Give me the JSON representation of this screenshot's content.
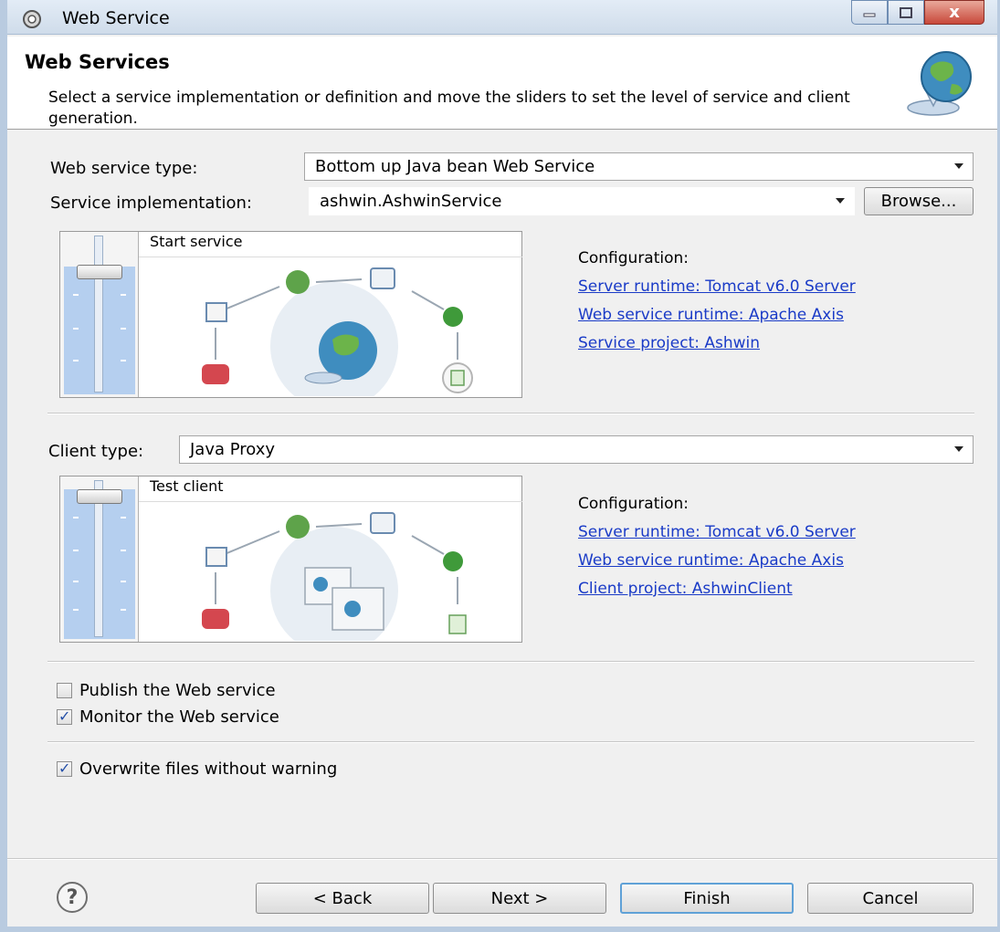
{
  "window": {
    "title": "Web Service",
    "minimize_icon": "minimize-icon",
    "maximize_icon": "maximize-icon",
    "close_icon": "close-icon",
    "close_glyph": "x"
  },
  "banner": {
    "title": "Web Services",
    "description": "Select a service implementation or definition and move the sliders to set the level of service and client generation.",
    "icon": "web-services-globe-icon"
  },
  "service": {
    "type_label": "Web service type:",
    "type_value": "Bottom up Java bean Web Service",
    "impl_label": "Service implementation:",
    "impl_value": "ashwin.AshwinService",
    "browse_label": "Browse...",
    "slider_caption": "Start service",
    "slider_level": 0.17,
    "config_heading": "Configuration:",
    "config_links": [
      "Server runtime: Tomcat v6.0 Server",
      "Web service runtime: Apache Axis",
      "Service project: Ashwin"
    ]
  },
  "client": {
    "type_label": "Client type:",
    "type_value": "Java Proxy",
    "slider_caption": "Test client",
    "slider_level": 0.0,
    "config_heading": "Configuration:",
    "config_links": [
      "Server runtime: Tomcat v6.0 Server",
      "Web service runtime: Apache Axis",
      "Client project: AshwinClient"
    ]
  },
  "options": {
    "publish": {
      "label": "Publish the Web service",
      "checked": false
    },
    "monitor": {
      "label": "Monitor the Web service",
      "checked": true
    },
    "overwrite": {
      "label": "Overwrite files without warning",
      "checked": true
    }
  },
  "footer": {
    "help_icon": "help-icon",
    "help_glyph": "?",
    "back_label": "< Back",
    "next_label": "Next >",
    "finish_label": "Finish",
    "cancel_label": "Cancel"
  },
  "colors": {
    "link": "#1a3bc7",
    "slider_fill": "#b5cfef",
    "finish_focus": "#5fa1d7"
  }
}
